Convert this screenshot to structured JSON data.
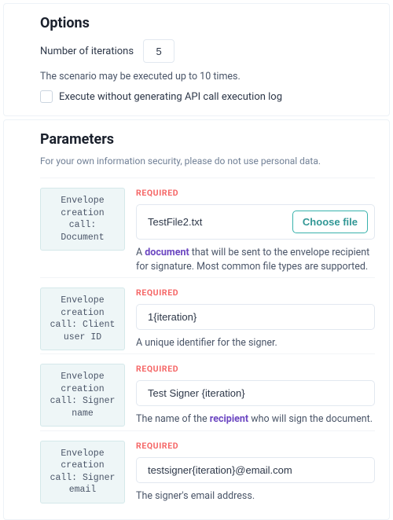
{
  "options": {
    "heading": "Options",
    "iterations_label": "Number of iterations",
    "iterations_value": "5",
    "iterations_hint": "The scenario may be executed up to 10 times.",
    "checkbox_label": "Execute without generating API call execution log"
  },
  "parameters": {
    "heading": "Parameters",
    "security_note": "For your own information security, please do not use personal data.",
    "required_label": "REQUIRED",
    "choose_file_label": "Choose file",
    "items": [
      {
        "label": "Envelope creation call: Document",
        "value": "TestFile2.txt",
        "has_file_button": true,
        "desc_pre": "A ",
        "desc_strong": "document",
        "desc_post": " that will be sent to the envelope recipient for signature. Most common file types are supported."
      },
      {
        "label": "Envelope creation call: Client user ID",
        "value": "1{iteration}",
        "desc_pre": "A unique identifier for the signer.",
        "desc_strong": "",
        "desc_post": ""
      },
      {
        "label": "Envelope creation call: Signer name",
        "value": "Test Signer {iteration}",
        "desc_pre": "The name of the ",
        "desc_strong": "recipient",
        "desc_post": " who will sign the document."
      },
      {
        "label": "Envelope creation call: Signer email",
        "value": "testsigner{iteration}@email.com",
        "desc_pre": "The signer's email address.",
        "desc_strong": "",
        "desc_post": ""
      }
    ]
  }
}
